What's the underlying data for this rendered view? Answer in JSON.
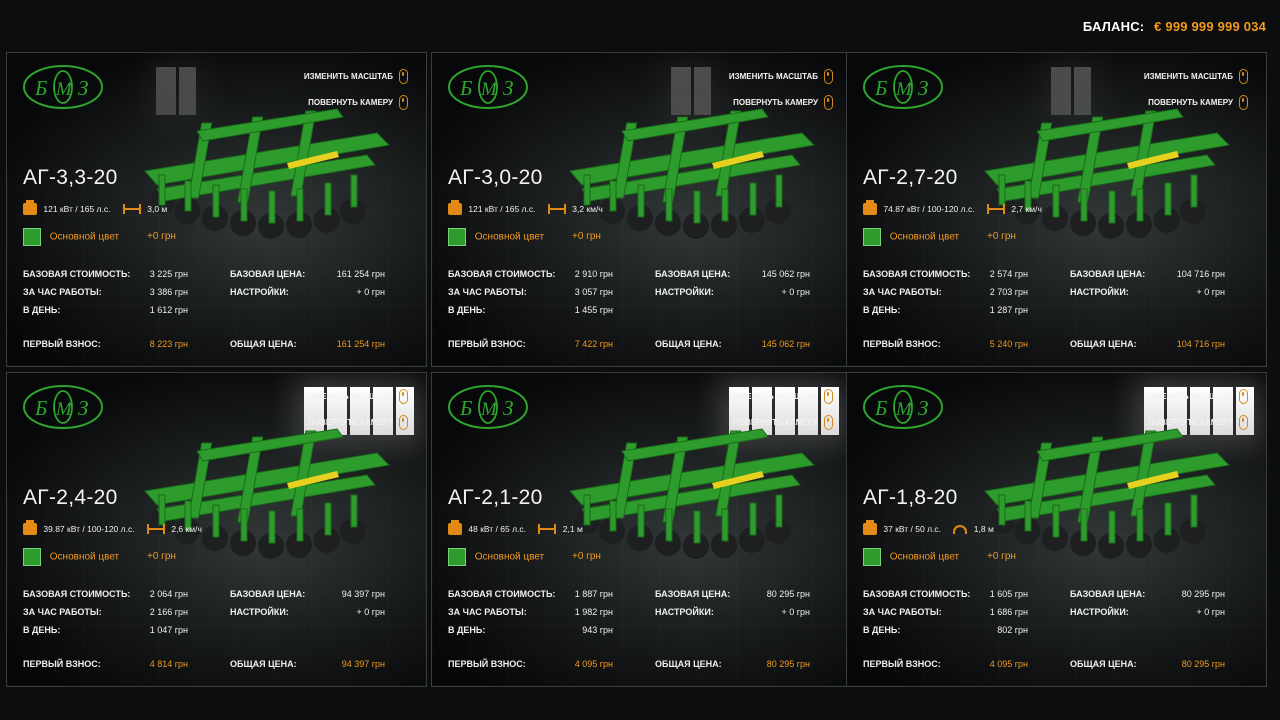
{
  "balance": {
    "label": "БАЛАНС:",
    "value": "€ 999 999 999 034"
  },
  "hints": {
    "scale": "ИЗМЕНИТЬ МАСШТАБ",
    "rotate": "ПОВЕРНУТЬ КАМЕРУ"
  },
  "labels": {
    "base_cost": "БАЗОВАЯ СТОИМОСТЬ:",
    "per_hour": "ЗА ЧАС РАБОТЫ:",
    "per_day": "В ДЕНЬ:",
    "base_price": "БАЗОВАЯ ЦЕНА:",
    "settings": "НАСТРОЙКИ:",
    "first_payment": "ПЕРВЫЙ ВЗНОС:",
    "total_price": "ОБЩАЯ ЦЕНА:",
    "main_color": "Основной цвет",
    "color_price": "+0 грн"
  },
  "colors": {
    "accent": "#f29a1f",
    "machine_green": "#2e9c2c"
  },
  "cards": [
    {
      "title": "АГ-3,3-20",
      "power": "121 кВт / 165 л.с.",
      "spec2": "3,0 м",
      "spec2_icon": "width-icon",
      "base_cost": "3 225 грн",
      "per_hour": "3 386 грн",
      "per_day": "1 612 грн",
      "base_price": "161 254 грн",
      "settings": "+ 0 грн",
      "first_payment": "8 223 грн",
      "total_price": "161 254 грн"
    },
    {
      "title": "АГ-3,0-20",
      "power": "121 кВт / 165 л.с.",
      "spec2": "3,2 км/ч",
      "spec2_icon": "width-icon",
      "base_cost": "2 910 грн",
      "per_hour": "3 057 грн",
      "per_day": "1 455 грн",
      "base_price": "145 062 грн",
      "settings": "+ 0 грн",
      "first_payment": "7 422 грн",
      "total_price": "145 062 грн"
    },
    {
      "title": "АГ-2,7-20",
      "power": "74.87 кВт / 100-120 л.с.",
      "spec2": "2,7 км/ч",
      "spec2_icon": "width-icon",
      "base_cost": "2 574 грн",
      "per_hour": "2 703 грн",
      "per_day": "1 287 грн",
      "base_price": "104 716 грн",
      "settings": "+ 0 грн",
      "first_payment": "5 240 грн",
      "total_price": "104 716 грн"
    },
    {
      "title": "АГ-2,4-20",
      "power": "39.87 кВт / 100-120 л.с.",
      "spec2": "2,6 км/ч",
      "spec2_icon": "width-icon",
      "base_cost": "2 064 грн",
      "per_hour": "2 166 грн",
      "per_day": "1 047 грн",
      "base_price": "94 397 грн",
      "settings": "+ 0 грн",
      "first_payment": "4 814 грн",
      "total_price": "94 397 грн"
    },
    {
      "title": "АГ-2,1-20",
      "power": "48 кВт / 65 л.с.",
      "spec2": "2,1 м",
      "spec2_icon": "width-icon",
      "base_cost": "1 887 грн",
      "per_hour": "1 982 грн",
      "per_day": "943 грн",
      "base_price": "80 295 грн",
      "settings": "+ 0 грн",
      "first_payment": "4 095 грн",
      "total_price": "80 295 грн"
    },
    {
      "title": "АГ-1,8-20",
      "power": "37 кВт / 50 л.с.",
      "spec2": "1,8 м",
      "spec2_icon": "speed-icon",
      "base_cost": "1 605 грн",
      "per_hour": "1 686 грн",
      "per_day": "802 грн",
      "base_price": "80 295 грн",
      "settings": "+ 0 грн",
      "first_payment": "4 095 грн",
      "total_price": "80 295 грн"
    }
  ]
}
